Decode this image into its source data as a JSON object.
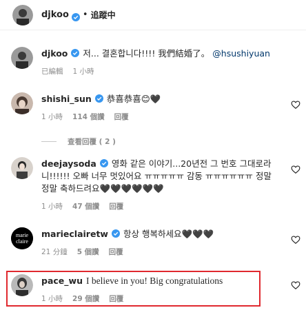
{
  "header": {
    "username": "djkoo",
    "separator": "•",
    "follow_label": "追蹤中"
  },
  "caption": {
    "username": "djkoo",
    "text": "저... 결혼합니다!!!! 我們結婚了。 ",
    "mention": "@hsushiyuan",
    "edited": "已編輯",
    "time": "1 小時"
  },
  "comments": [
    {
      "username": "shishi_sun",
      "text": "恭喜恭喜😊🖤",
      "time": "1 小時",
      "likes": "114 個讚",
      "reply": "回覆"
    },
    {
      "username": "deejaysoda",
      "text_line1": "영화 같은 이야기...20년전 그 번호 그대로라",
      "text_line2": "니!!!!!! 오빠 너무 멋있어요 ㅠㅠㅠㅠㅠ 감동 ㅠㅠㅠㅠㅠㅠ 정말",
      "text_line3": "정말 축하드려요🖤🖤🖤🖤🖤🖤",
      "time": "1 小時",
      "likes": "47 個讚",
      "reply": "回覆"
    },
    {
      "username": "marieclairetw",
      "avatar_text_top": "marie",
      "avatar_text_bottom": "claire",
      "text": "항상 행복하세요🖤🖤🖤",
      "time": "21 分鐘",
      "likes": "5 個讚",
      "reply": "回覆"
    },
    {
      "username": "pace_wu",
      "text": "I believe in you! Big congratulations",
      "time": "1 小時",
      "likes": "29 個讚",
      "reply": "回覆"
    }
  ],
  "view_replies": "查看回覆 ( 2 )",
  "colors": {
    "verified": "#3897f0",
    "highlight": "#e0282e",
    "meta": "#8e8e8e",
    "mention": "#00376b"
  }
}
